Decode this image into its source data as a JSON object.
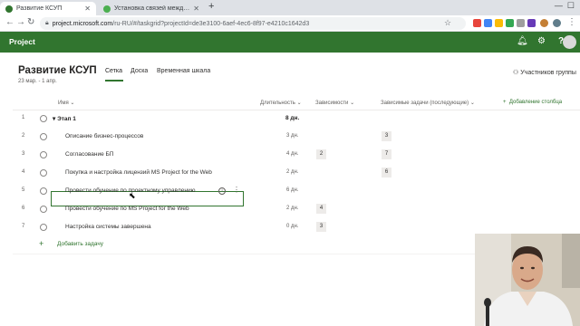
{
  "browser": {
    "tabs": [
      {
        "title": "Развитие КСУП",
        "active": true
      },
      {
        "title": "Установка связей между задач...",
        "active": false
      }
    ],
    "new_tab_symbol": "+",
    "url_host": "project.microsoft.com",
    "url_path": "/ru-RU/#/taskgrid?projectId=de3e3100-6aef-4ec6-8f97-e4210c1642d3"
  },
  "app": {
    "name": "Project",
    "accent_color": "#31752f"
  },
  "project": {
    "title": "Развитие КСУП",
    "dates": "23 мар. - 1 апр.",
    "views": [
      "Сетка",
      "Доска",
      "Временная шкала"
    ],
    "active_view": "Сетка",
    "members_label": "Участников группы"
  },
  "grid": {
    "columns": {
      "name": "Имя",
      "duration": "Длительность",
      "dependencies": "Зависимости",
      "successors": "Зависимые задачи (последующие)",
      "add_column": "Добавление столбца"
    },
    "rows": [
      {
        "num": "1",
        "name": "Этап 1",
        "duration": "8 дн.",
        "dep": "",
        "succ": "",
        "summary": true
      },
      {
        "num": "2",
        "name": "Описание бизнес-процессов",
        "duration": "3 дн.",
        "dep": "",
        "succ": "3"
      },
      {
        "num": "3",
        "name": "Согласование БП",
        "duration": "4 дн.",
        "dep": "2",
        "succ": "7"
      },
      {
        "num": "4",
        "name": "Покупка и настройка лицензий MS Project for the Web",
        "duration": "2 дн.",
        "dep": "",
        "succ": "6"
      },
      {
        "num": "5",
        "name": "Провести обучение по проектному управлению",
        "duration": "6 дн.",
        "dep": "",
        "succ": ""
      },
      {
        "num": "6",
        "name": "Провести обучение по MS Project for the Web",
        "duration": "2 дн.",
        "dep": "4",
        "succ": ""
      },
      {
        "num": "7",
        "name": "Настройка системы завершена",
        "duration": "0 дн.",
        "dep": "3",
        "succ": ""
      }
    ],
    "add_task_label": "Добавить задачу"
  }
}
